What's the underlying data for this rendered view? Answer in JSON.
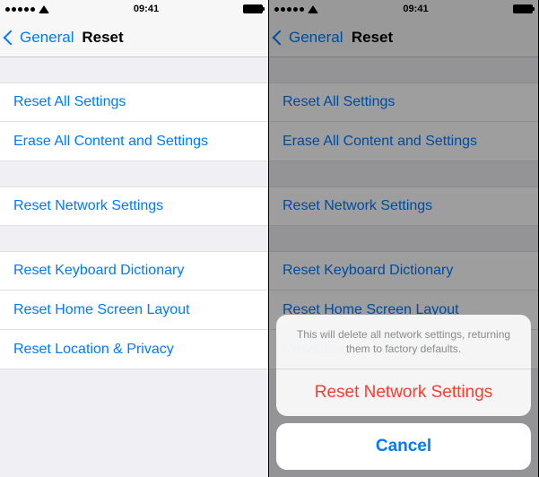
{
  "status": {
    "time": "09:41",
    "carrier": "•••••",
    "wifi_icon": "wifi",
    "battery_icon": "battery-full"
  },
  "nav": {
    "back_label": "General",
    "title": "Reset"
  },
  "groups": {
    "g1": {
      "reset_all": "Reset All Settings",
      "erase_all": "Erase All Content and Settings"
    },
    "g2": {
      "reset_network": "Reset Network Settings"
    },
    "g3": {
      "reset_keyboard": "Reset Keyboard Dictionary",
      "reset_home": "Reset Home Screen Layout",
      "reset_location": "Reset Location & Privacy"
    }
  },
  "sheet": {
    "message": "This will delete all network settings, returning them to factory defaults.",
    "destructive_label": "Reset Network Settings",
    "cancel_label": "Cancel"
  },
  "colors": {
    "link": "#007aff",
    "destructive": "#ff3b30",
    "bg": "#efeff4"
  }
}
